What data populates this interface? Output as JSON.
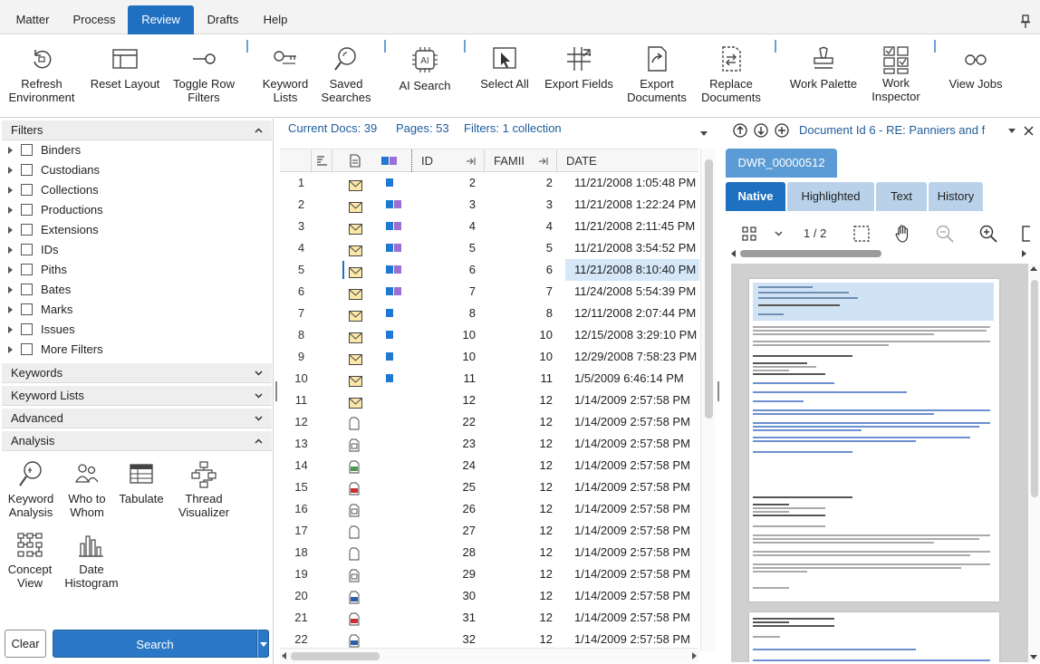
{
  "menu": {
    "items": [
      "Matter",
      "Process",
      "Review",
      "Drafts",
      "Help"
    ],
    "active": "Review"
  },
  "ribbon": {
    "refresh_environment": "Refresh\nEnvironment",
    "reset_layout": "Reset Layout",
    "toggle_row_filters": "Toggle Row\nFilters",
    "keyword_lists": "Keyword\nLists",
    "saved_searches": "Saved\nSearches",
    "ai_search": "AI Search",
    "select_all": "Select All",
    "export_fields": "Export Fields",
    "export_documents": "Export\nDocuments",
    "replace_documents": "Replace\nDocuments",
    "work_palette": "Work Palette",
    "work_inspector": "Work\nInspector",
    "view_jobs": "View Jobs",
    "ai_badge": "AI"
  },
  "filters": {
    "header": "Filters",
    "items": [
      "Binders",
      "Custodians",
      "Collections",
      "Productions",
      "Extensions",
      "IDs",
      "Piths",
      "Bates",
      "Marks",
      "Issues",
      "More Filters"
    ]
  },
  "sections": {
    "keywords": "Keywords",
    "keyword_lists": "Keyword Lists",
    "advanced": "Advanced",
    "analysis": "Analysis"
  },
  "analysis_tools": {
    "keyword_analysis": "Keyword\nAnalysis",
    "who_to_whom": "Who to\nWhom",
    "tabulate": "Tabulate",
    "thread_visualizer": "Thread\nVisualizer",
    "concept_view": "Concept\nView",
    "date_histogram": "Date\nHistogram"
  },
  "buttons": {
    "clear": "Clear",
    "search": "Search"
  },
  "grid": {
    "current_docs": "Current Docs: 39",
    "pages": "Pages: 53",
    "filters": "Filters: 1 collection",
    "columns": {
      "id": "ID",
      "family": "FAMII",
      "date": "DATE"
    },
    "rows": [
      {
        "n": "1",
        "icon": "email",
        "colors": [
          "#1f78d1"
        ],
        "id": "2",
        "fam": "2",
        "date": "11/21/2008 1:05:48 PM"
      },
      {
        "n": "2",
        "icon": "email",
        "colors": [
          "#1f78d1",
          "#9b6fd6"
        ],
        "id": "3",
        "fam": "3",
        "date": "11/21/2008 1:22:24 PM"
      },
      {
        "n": "3",
        "icon": "email",
        "colors": [
          "#1f78d1",
          "#9b6fd6"
        ],
        "id": "4",
        "fam": "4",
        "date": "11/21/2008 2:11:45 PM"
      },
      {
        "n": "4",
        "icon": "email",
        "colors": [
          "#1f78d1",
          "#9b6fd6"
        ],
        "id": "5",
        "fam": "5",
        "date": "11/21/2008 3:54:52 PM"
      },
      {
        "n": "5",
        "icon": "email",
        "colors": [
          "#1f78d1",
          "#9b6fd6"
        ],
        "id": "6",
        "fam": "6",
        "date": "11/21/2008 8:10:40 PM",
        "selected": true
      },
      {
        "n": "6",
        "icon": "email",
        "colors": [
          "#1f78d1",
          "#9b6fd6"
        ],
        "id": "7",
        "fam": "7",
        "date": "11/24/2008 5:54:39 PM"
      },
      {
        "n": "7",
        "icon": "email",
        "colors": [
          "#1f78d1"
        ],
        "id": "8",
        "fam": "8",
        "date": "12/11/2008 2:07:44 PM"
      },
      {
        "n": "8",
        "icon": "email",
        "colors": [
          "#1f78d1"
        ],
        "id": "10",
        "fam": "10",
        "date": "12/15/2008 3:29:10 PM"
      },
      {
        "n": "9",
        "icon": "email",
        "colors": [
          "#1f78d1"
        ],
        "id": "10",
        "fam": "10",
        "date": "12/29/2008 7:58:23 PM"
      },
      {
        "n": "10",
        "icon": "email",
        "colors": [
          "#1f78d1"
        ],
        "id": "11",
        "fam": "11",
        "date": "1/5/2009 6:46:14 PM"
      },
      {
        "n": "11",
        "icon": "email",
        "colors": [],
        "id": "12",
        "fam": "12",
        "date": "1/14/2009 2:57:58 PM"
      },
      {
        "n": "12",
        "icon": "doc",
        "colors": [],
        "id": "22",
        "fam": "12",
        "date": "1/14/2009 2:57:58 PM"
      },
      {
        "n": "13",
        "icon": "img",
        "colors": [],
        "id": "23",
        "fam": "12",
        "date": "1/14/2009 2:57:58 PM"
      },
      {
        "n": "14",
        "icon": "green",
        "colors": [],
        "id": "24",
        "fam": "12",
        "date": "1/14/2009 2:57:58 PM"
      },
      {
        "n": "15",
        "icon": "red",
        "colors": [],
        "id": "25",
        "fam": "12",
        "date": "1/14/2009 2:57:58 PM"
      },
      {
        "n": "16",
        "icon": "img",
        "colors": [],
        "id": "26",
        "fam": "12",
        "date": "1/14/2009 2:57:58 PM"
      },
      {
        "n": "17",
        "icon": "doc",
        "colors": [],
        "id": "27",
        "fam": "12",
        "date": "1/14/2009 2:57:58 PM"
      },
      {
        "n": "18",
        "icon": "doc",
        "colors": [],
        "id": "28",
        "fam": "12",
        "date": "1/14/2009 2:57:58 PM"
      },
      {
        "n": "19",
        "icon": "img",
        "colors": [],
        "id": "29",
        "fam": "12",
        "date": "1/14/2009 2:57:58 PM"
      },
      {
        "n": "20",
        "icon": "blue",
        "colors": [],
        "id": "30",
        "fam": "12",
        "date": "1/14/2009 2:57:58 PM"
      },
      {
        "n": "21",
        "icon": "red",
        "colors": [],
        "id": "31",
        "fam": "12",
        "date": "1/14/2009 2:57:58 PM"
      },
      {
        "n": "22",
        "icon": "blue",
        "colors": [],
        "id": "32",
        "fam": "12",
        "date": "1/14/2009 2:57:58 PM"
      }
    ]
  },
  "viewer": {
    "title": "Document Id 6 - RE: Panniers and f",
    "doc_tab": "DWR_00000512",
    "tabs": [
      "Native",
      "Highlighted",
      "Text",
      "History"
    ],
    "active_tab": "Native",
    "page_indicator": "1 / 2",
    "email": {
      "subject": "RE: Panniers and fenders"
    }
  },
  "colors": {
    "accent": "#1f70c1",
    "link_text": "#1f5c9c",
    "selected_row": "#d6e8f8",
    "tab_inactive": "#b9d2ea"
  }
}
